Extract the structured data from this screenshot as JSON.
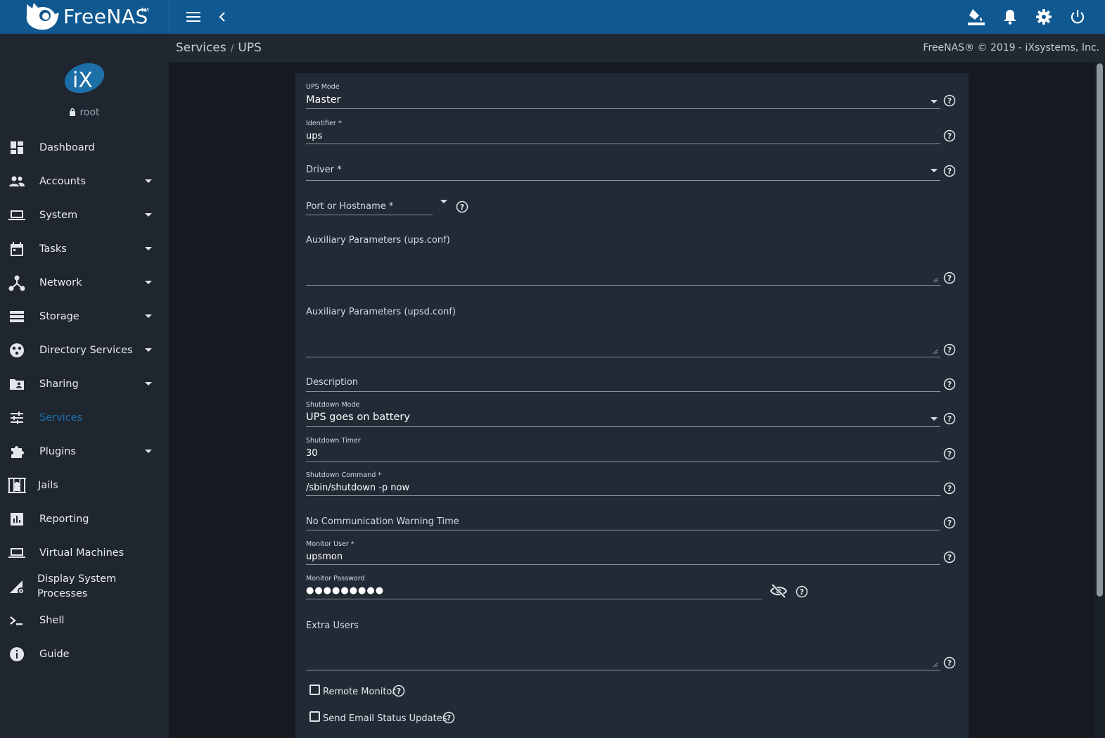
{
  "brand": {
    "name": "FreeNAS",
    "tm": "TM"
  },
  "user": {
    "name": "root"
  },
  "breadcrumb": {
    "parent": "Services",
    "separator": "/",
    "current": "UPS"
  },
  "copyright": "FreeNAS® © 2019 - iXsystems, Inc.",
  "colors": {
    "topbar": "#0f5890",
    "sidebar": "#1f2630",
    "card": "#222a35",
    "active": "#1f6fb0"
  },
  "topbar_icons": [
    "menu-icon",
    "chevron-left-icon",
    "theme-bucket-icon",
    "bell-icon",
    "gear-icon",
    "power-icon"
  ],
  "sidebar": {
    "items": [
      {
        "label": "Dashboard",
        "icon": "dashboard-icon",
        "expandable": false
      },
      {
        "label": "Accounts",
        "icon": "people-icon",
        "expandable": true
      },
      {
        "label": "System",
        "icon": "laptop-icon",
        "expandable": true
      },
      {
        "label": "Tasks",
        "icon": "calendar-icon",
        "expandable": true
      },
      {
        "label": "Network",
        "icon": "network-icon",
        "expandable": true
      },
      {
        "label": "Storage",
        "icon": "storage-icon",
        "expandable": true
      },
      {
        "label": "Directory Services",
        "icon": "directory-icon",
        "expandable": true
      },
      {
        "label": "Sharing",
        "icon": "folder-shared-icon",
        "expandable": true
      },
      {
        "label": "Services",
        "icon": "tune-icon",
        "expandable": false,
        "active": true
      },
      {
        "label": "Plugins",
        "icon": "puzzle-icon",
        "expandable": true
      },
      {
        "label": "Jails",
        "icon": "jail-icon",
        "expandable": false
      },
      {
        "label": "Reporting",
        "icon": "bar-chart-icon",
        "expandable": false
      },
      {
        "label": "Virtual Machines",
        "icon": "laptop-icon",
        "expandable": false
      },
      {
        "label": "Display System Processes",
        "icon": "processes-icon",
        "expandable": false
      },
      {
        "label": "Shell",
        "icon": "shell-icon",
        "expandable": false
      },
      {
        "label": "Guide",
        "icon": "info-icon",
        "expandable": false
      }
    ]
  },
  "form": {
    "ups_mode": {
      "label": "UPS Mode",
      "value": "Master"
    },
    "identifier": {
      "label": "Identifier *",
      "value": "ups"
    },
    "driver": {
      "label": "Driver *",
      "value": ""
    },
    "port": {
      "label": "Port or Hostname *",
      "value": ""
    },
    "aux_ups": {
      "label": "Auxiliary Parameters (ups.conf)",
      "value": ""
    },
    "aux_upsd": {
      "label": "Auxiliary Parameters (upsd.conf)",
      "value": ""
    },
    "description": {
      "label": "Description",
      "value": ""
    },
    "shutdown_mode": {
      "label": "Shutdown Mode",
      "value": "UPS goes on battery"
    },
    "shutdown_timer": {
      "label": "Shutdown Timer",
      "value": "30"
    },
    "shutdown_command": {
      "label": "Shutdown Command *",
      "value": "/sbin/shutdown -p now"
    },
    "nocomm_warn": {
      "label": "No Communication Warning Time",
      "value": ""
    },
    "monitor_user": {
      "label": "Monitor User *",
      "value": "upsmon"
    },
    "monitor_password": {
      "label": "Monitor Password",
      "value": "●●●●●●●●●"
    },
    "extra_users": {
      "label": "Extra Users",
      "value": ""
    },
    "remote_monitor": {
      "label": "Remote Monitor",
      "checked": false
    },
    "email_updates": {
      "label": "Send Email Status Updates",
      "checked": false
    }
  }
}
